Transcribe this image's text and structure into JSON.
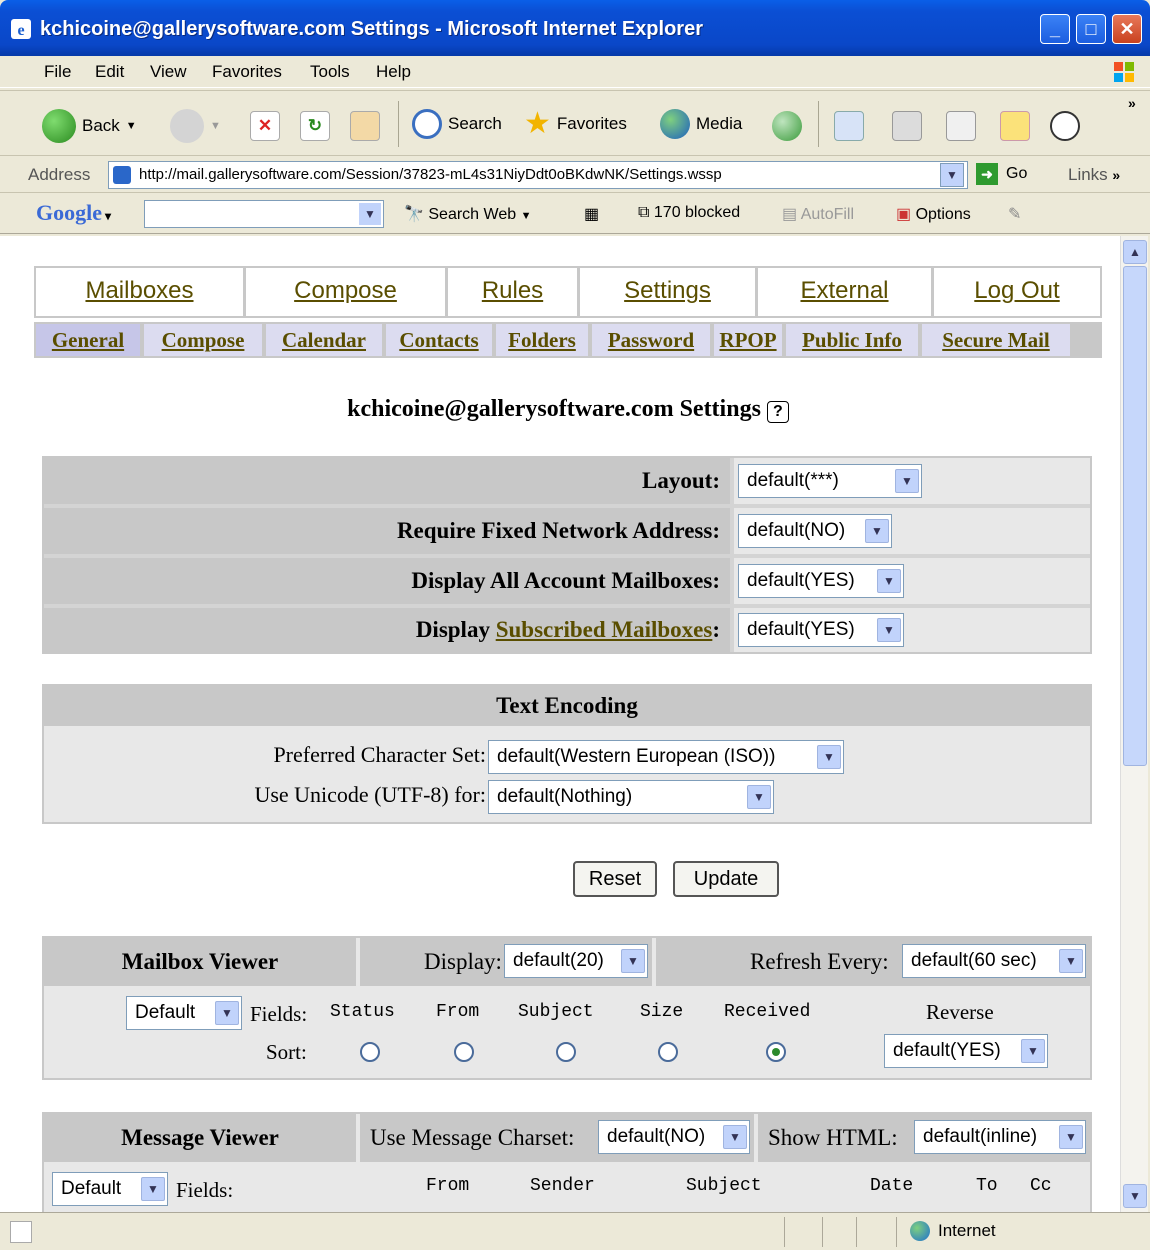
{
  "window": {
    "title": "kchicoine@gallerysoftware.com Settings - Microsoft Internet Explorer",
    "controls": {
      "minimize": "_",
      "maximize": "□",
      "close": "✕"
    }
  },
  "menu": [
    "File",
    "Edit",
    "View",
    "Favorites",
    "Tools",
    "Help"
  ],
  "toolbar": {
    "back": "Back",
    "search": "Search",
    "favorites": "Favorites",
    "media": "Media"
  },
  "address": {
    "label": "Address",
    "url": "http://mail.gallerysoftware.com/Session/37823-mL4s31NiyDdt0oBKdwNK/Settings.wssp",
    "go": "Go",
    "links": "Links"
  },
  "googlebar": {
    "logo": "Google",
    "search_web": "Search Web",
    "blocked": "170 blocked",
    "autofill": "AutoFill",
    "options": "Options"
  },
  "main_tabs": [
    "Mailboxes",
    "Compose",
    "Rules",
    "Settings",
    "External",
    "Log Out"
  ],
  "sub_tabs": [
    "General",
    "Compose",
    "Calendar",
    "Contacts",
    "Folders",
    "Password",
    "RPOP",
    "Public Info",
    "Secure Mail"
  ],
  "page": {
    "title": "kchicoine@gallerysoftware.com Settings",
    "help": "?"
  },
  "settings": {
    "layout_label": "Layout:",
    "layout_value": "default(***)",
    "fixed_label": "Require Fixed Network Address:",
    "fixed_value": "default(NO)",
    "display_all_label": "Display All Account Mailboxes:",
    "display_all_value": "default(YES)",
    "display_sub_prefix": "Display",
    "display_sub_link": "Subscribed Mailboxes",
    "display_sub_colon": ":",
    "display_sub_value": "default(YES)"
  },
  "encoding": {
    "heading": "Text Encoding",
    "charset_label": "Preferred Character Set:",
    "charset_value": "default(Western European (ISO))",
    "unicode_label": "Use Unicode (UTF-8) for:",
    "unicode_value": "default(Nothing)"
  },
  "buttons": {
    "reset": "Reset",
    "update": "Update"
  },
  "mailbox_viewer": {
    "heading": "Mailbox Viewer",
    "display_label": "Display:",
    "display_value": "default(20)",
    "refresh_label": "Refresh Every:",
    "refresh_value": "default(60 sec)",
    "preset_value": "Default",
    "fields_label": "Fields:",
    "sort_label": "Sort:",
    "columns": [
      "Status",
      "From",
      "Subject",
      "Size",
      "Received"
    ],
    "reverse_label": "Reverse",
    "reverse_value": "default(YES)",
    "sorted_column": "Received"
  },
  "message_viewer": {
    "heading": "Message Viewer",
    "charset_label": "Use Message Charset:",
    "charset_value": "default(NO)",
    "html_label": "Show HTML:",
    "html_value": "default(inline)",
    "preset_value": "Default",
    "fields_label": "Fields:",
    "columns": [
      "From",
      "Sender",
      "Subject",
      "Date",
      "To",
      "Cc"
    ]
  },
  "status": {
    "zone": "Internet"
  }
}
